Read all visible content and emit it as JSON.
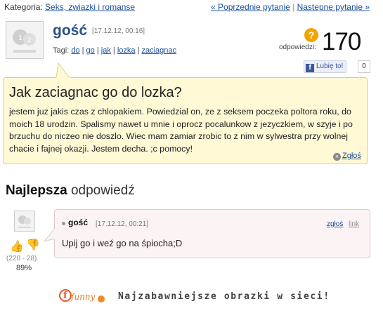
{
  "category": {
    "label": "Kategoria:",
    "value": "Seks, zwiazki i romanse"
  },
  "nav": {
    "prev": "« Poprzednie pytanie",
    "separator": "|",
    "next": "Nastepne pytanie »"
  },
  "question": {
    "author": "gość",
    "date": "[17.12.12, 00:16]",
    "tags_label": "Tagi:",
    "tags": [
      "do",
      "go",
      "jak",
      "lozka",
      "zaciagnac"
    ],
    "answers_label": "odpowiedzi:",
    "answers_count": "170",
    "like_label": "Lubię to!",
    "like_count": "0",
    "title": "Jak zaciagnac go do lozka?",
    "body": "jestem juz jakis czas z chlopakiem. Powiedzial on, ze z seksem poczeka poltora roku, do moich 18 urodzin. Spalismy nawet u mnie i oprocz pocalunkow z jezyczkiem, w szyje i po brzuchu do niczeo nie doszlo. Wiec mam zamiar zrobic to z nim w sylwestra przy wolnej chacie i fajnej okazji. Jestem decha. ;c pomocy!",
    "report": "Zgłoś"
  },
  "best": {
    "heading_bold": "Najlepsza",
    "heading_rest": "odpowiedź",
    "votes": "(220 - 28)",
    "percent": "89%",
    "author": "gość",
    "date": "[17.12.12, 00:21]",
    "report": "zgłoś",
    "link": "link",
    "text": "Upij go i weź go na śpiocha;D"
  },
  "footer": {
    "logo_text": "funny",
    "tagline": "Najzabawniejsze obrazki w sieci!"
  },
  "colors": {
    "bubble": "#fff9d6",
    "answer_bg": "#fcf4f4",
    "link": "#1a4fa0",
    "author": "#2a4f86"
  },
  "icons": [
    "question-icon",
    "facebook-icon",
    "close-icon",
    "thumbs-up-icon",
    "thumbs-down-icon",
    "avatar-icon"
  ]
}
